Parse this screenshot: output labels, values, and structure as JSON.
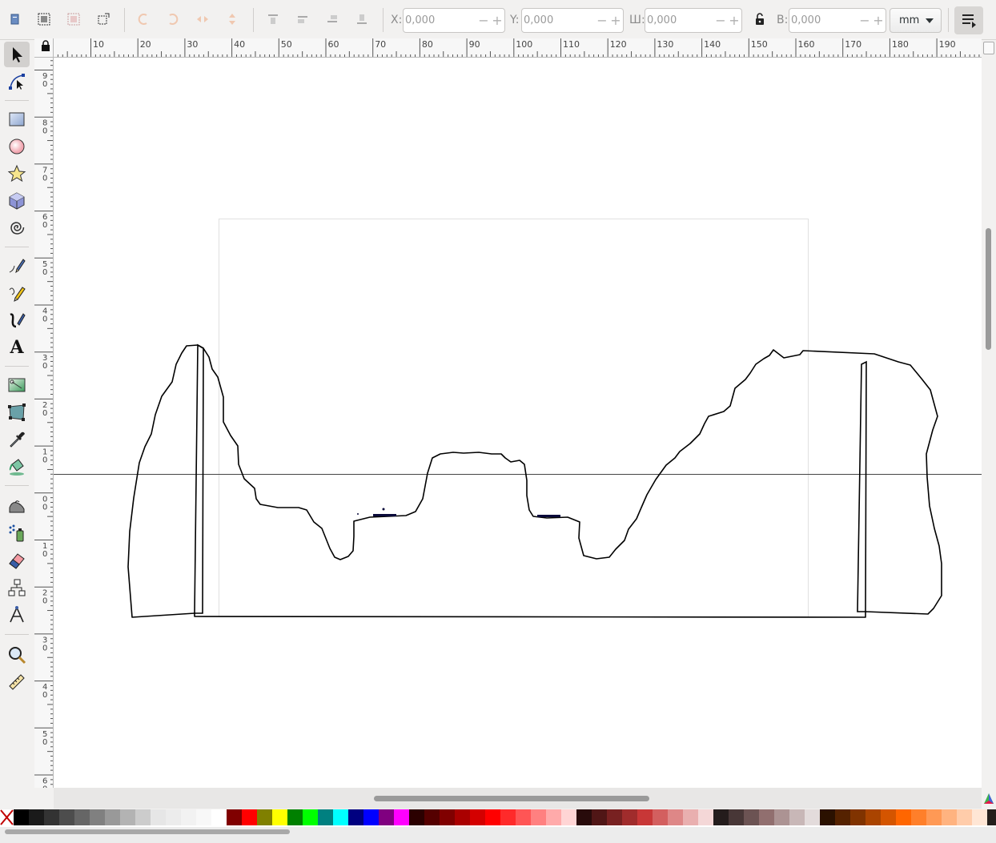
{
  "controls": {
    "x_label": "X:",
    "x_value": "0,000",
    "y_label": "Y:",
    "y_value": "0,000",
    "w_label": "Ш:",
    "w_value": "0,000",
    "h_label": "В:",
    "h_value": "0,000",
    "minus": "−",
    "plus": "+",
    "unit": "mm"
  },
  "rulers": {
    "horizontal_labels": [
      "10",
      "20",
      "30",
      "40",
      "50",
      "60",
      "70",
      "80",
      "90",
      "100",
      "110",
      "120",
      "130",
      "140",
      "150",
      "160",
      "170",
      "180",
      "190"
    ],
    "vertical_labels": [
      "9",
      "8",
      "7",
      "6",
      "5",
      "4",
      "3",
      "2",
      "1",
      "0",
      "1",
      "2",
      "3",
      "4",
      "5",
      "6"
    ]
  },
  "toolbox": [
    "selector-tool",
    "node-tool",
    "rectangle-tool",
    "ellipse-tool",
    "star-tool",
    "box3d-tool",
    "spiral-tool",
    "pen-tool",
    "pencil-tool",
    "calligraphy-tool",
    "text-tool",
    "gradient-tool",
    "mesh-tool",
    "dropper-tool",
    "paint-bucket-tool",
    "tweak-tool",
    "spray-tool",
    "eraser-tool",
    "connector-tool",
    "lpe-tool",
    "zoom-tool",
    "measure-tool"
  ],
  "text_tool_glyph": "A",
  "palette": [
    "#000000",
    "#1a1a1a",
    "#333333",
    "#4d4d4d",
    "#666666",
    "#808080",
    "#999999",
    "#b3b3b3",
    "#cccccc",
    "#e6e6e6",
    "#ececec",
    "#f2f2f2",
    "#f8f8f8",
    "#ffffff",
    "#800000",
    "#ff0000",
    "#808000",
    "#ffff00",
    "#008000",
    "#00ff00",
    "#008080",
    "#00ffff",
    "#000080",
    "#0000ff",
    "#800080",
    "#ff00ff",
    "#2b0000",
    "#550000",
    "#800000",
    "#aa0000",
    "#d40000",
    "#ff0000",
    "#ff2a2a",
    "#ff5555",
    "#ff8080",
    "#ffaaaa",
    "#ffd5d5",
    "#280b0b",
    "#501616",
    "#782121",
    "#a02c2c",
    "#c83737",
    "#d35f5f",
    "#de8787",
    "#e9afaf",
    "#f4d7d7",
    "#241c1c",
    "#483737",
    "#6c5353",
    "#916f6f",
    "#ac9393",
    "#c8b7b7",
    "#e3dbdb",
    "#2b1100",
    "#552200",
    "#803300",
    "#aa4400",
    "#d45500",
    "#ff6600",
    "#ff7f2a",
    "#ff9955",
    "#ffb380",
    "#ffccaa",
    "#ffe6d5",
    "#241f1c"
  ]
}
